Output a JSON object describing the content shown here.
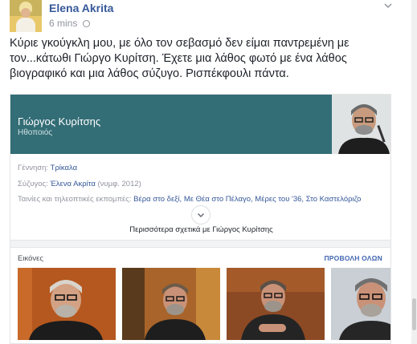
{
  "post": {
    "author": "Elena Akrita",
    "time": "6 mins",
    "text": "Κύριε γκούγκλη μου, με όλο τον σεβασμό δεν είμαι παντρεμένη με τον...κάτωθι Γιώργο Κυρίτση. Έχετε μια λάθος φωτό με ένα λάθος βιογραφικό και μια λάθος σύζυγο. Ρισπέκφουλι πάντα."
  },
  "card": {
    "name": "Γιώργος Κυρίτσης",
    "role": "Ηθοποιός",
    "facts": [
      {
        "label": "Γέννηση: ",
        "value": "Τρίκαλα",
        "suffix": ""
      },
      {
        "label": "Σύζυγος: ",
        "value": "Έλενα Ακρίτα",
        "suffix": " (νυμφ. 2012)"
      },
      {
        "label": "Ταινίες και τηλεοπτικές εκπομπές: ",
        "value": "Βέρα στο δεξί, Με Θέα στο Πέλαγο, Μέρες του '36, Στο Καστελόριζο",
        "suffix": ""
      }
    ],
    "more": "Περισσότερα σχετικά με Γιώργος Κυρίτσης",
    "images_heading": "Εικόνες",
    "see_all": "ΠΡΟΒΟΛΗ ΟΛΩΝ",
    "thumb_colors": [
      "#b5581f",
      "#a8642a",
      "#8c4a24",
      "#c9cfd4"
    ]
  }
}
